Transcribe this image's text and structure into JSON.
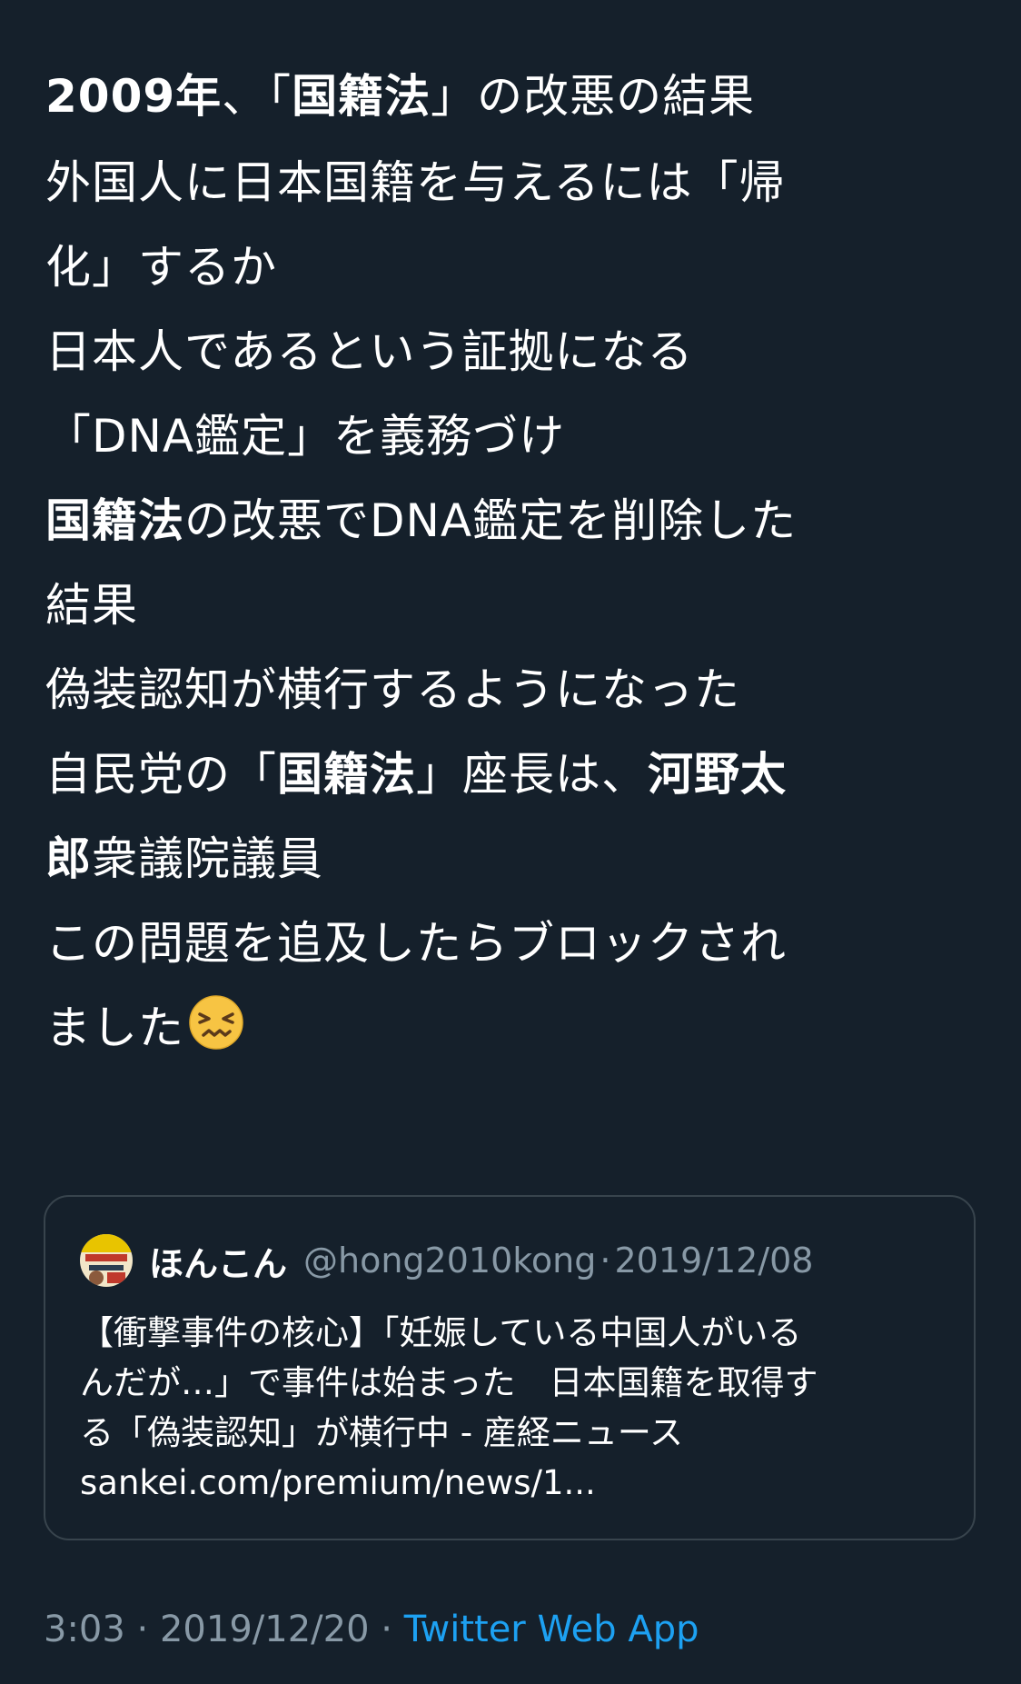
{
  "tweet": {
    "p1": {
      "l1_b1": "2009年",
      "l1_t1": "、「",
      "l1_b2": "国籍法",
      "l1_t2": "」の改悪の結果"
    },
    "p2": [
      "外国人に日本国籍を与えるには「帰",
      "化」するか",
      "日本人であるという証拠になる",
      "「DNA鑑定」を義務づけ"
    ],
    "p3": {
      "l1_b": "国籍法",
      "l1_t": "の改悪でDNA鑑定を削除した",
      "l2": "結果",
      "l3": "偽装認知が横行するようになった"
    },
    "p4": {
      "l1_t1": "自民党の「",
      "l1_b1": "国籍法",
      "l1_t2": "」座長は、",
      "l1_b2": "河野太",
      "l2_b": "郎",
      "l2_t": "衆議院議員",
      "l3": "この問題を追及したらブロックされ",
      "l4": "ました",
      "emoji": "confounded-face"
    }
  },
  "quote": {
    "name": "ほんこん",
    "handle": "@hong2010kong",
    "separator": "·",
    "date": "2019/12/08",
    "lines": [
      "【衝撃事件の核心】「妊娠している中国人がいる",
      "んだが…」で事件は始まった　日本国籍を取得す",
      "る「偽装認知」が横行中 - 産経ニュース",
      "sankei.com/premium/news/1..."
    ]
  },
  "meta": {
    "time": "3:03",
    "separator": "·",
    "date": "2019/12/20",
    "app": "Twitter Web App"
  },
  "colors": {
    "background": "#15202b",
    "text": "#ffffff",
    "muted": "#8899a6",
    "link": "#1da1f2",
    "border": "#38444d"
  }
}
